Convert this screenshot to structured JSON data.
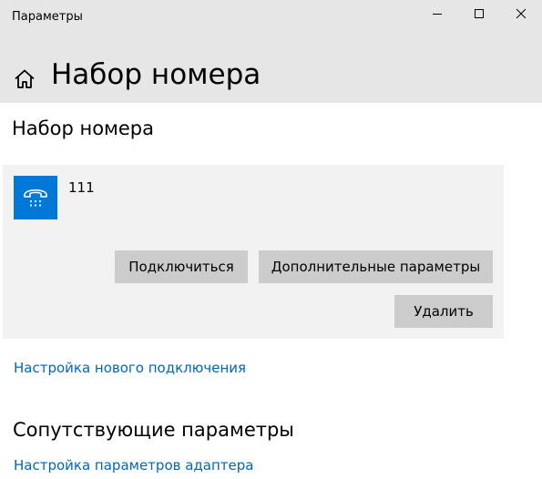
{
  "window": {
    "title": "Параметры",
    "controls": {
      "minimize_icon": "minimize-icon",
      "maximize_icon": "maximize-icon",
      "close_icon": "close-icon"
    }
  },
  "header": {
    "home_icon": "home-icon",
    "title": "Набор номера"
  },
  "section": {
    "title": "Набор номера"
  },
  "connection": {
    "icon": "dialup-phone-icon",
    "name": "111",
    "buttons": {
      "connect": "Подключиться",
      "advanced": "Дополнительные параметры",
      "delete": "Удалить"
    }
  },
  "links": {
    "new_connection": "Настройка нового подключения",
    "adapter_settings": "Настройка параметров адаптера"
  },
  "related": {
    "title": "Сопутствующие параметры"
  },
  "colors": {
    "header_bg": "#e6e6e6",
    "card_bg": "#f2f2f2",
    "button_bg": "#cccccc",
    "accent": "#0078d7",
    "link": "#0067b8"
  }
}
